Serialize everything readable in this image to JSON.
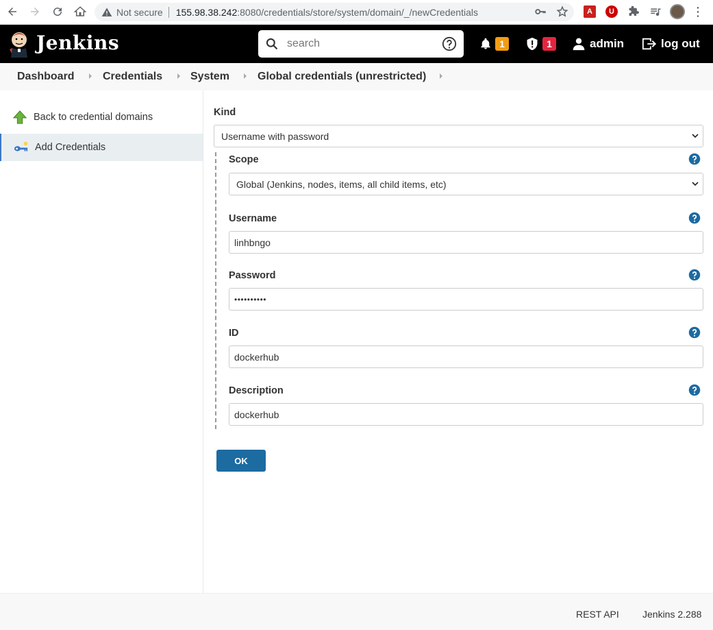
{
  "browser": {
    "not_secure_label": "Not secure",
    "url_host": "155.98.38.242",
    "url_rest": ":8080/credentials/store/system/domain/_/newCredentials"
  },
  "header": {
    "title": "Jenkins",
    "search_placeholder": "search",
    "notifications_count": "1",
    "security_count": "1",
    "user_label": "admin",
    "logout_label": "log out"
  },
  "breadcrumb": {
    "items": [
      "Dashboard",
      "Credentials",
      "System",
      "Global credentials (unrestricted)"
    ]
  },
  "sidebar": {
    "items": [
      {
        "label": "Back to credential domains",
        "icon": "up-arrow-icon"
      },
      {
        "label": "Add Credentials",
        "icon": "key-icon"
      }
    ]
  },
  "form": {
    "kind_label": "Kind",
    "kind_value": "Username with password",
    "scope_label": "Scope",
    "scope_value": "Global (Jenkins, nodes, items, all child items, etc)",
    "username_label": "Username",
    "username_value": "linhbngo",
    "password_label": "Password",
    "password_value": "••••••••••",
    "id_label": "ID",
    "id_value": "dockerhub",
    "description_label": "Description",
    "description_value": "dockerhub",
    "ok_label": "OK"
  },
  "footer": {
    "rest_api_label": "REST API",
    "version_label": "Jenkins 2.288"
  }
}
